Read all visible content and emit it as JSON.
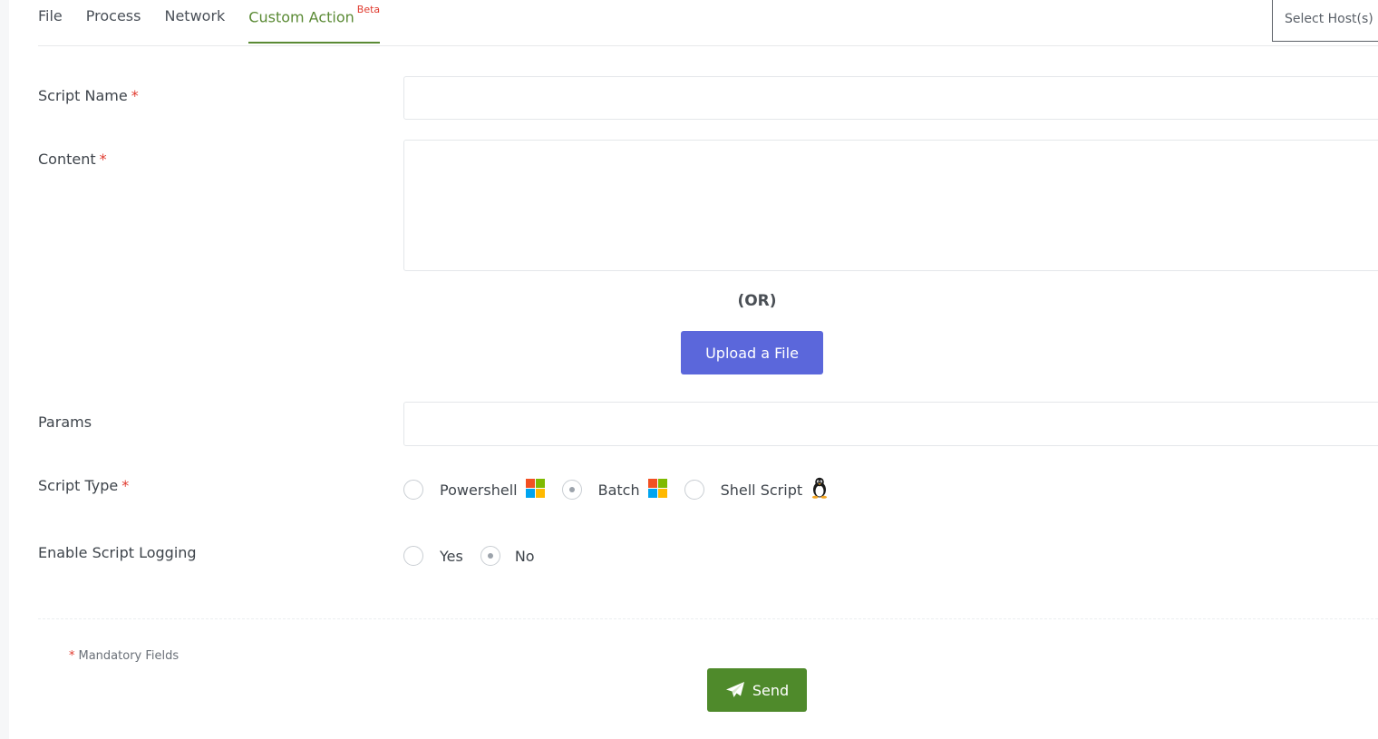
{
  "tabs": [
    {
      "label": "File"
    },
    {
      "label": "Process"
    },
    {
      "label": "Network"
    },
    {
      "label": "Custom Action",
      "badge": "Beta",
      "active": true
    }
  ],
  "host_select": {
    "placeholder": "Select Host(s)"
  },
  "form": {
    "script_name": {
      "label": "Script Name",
      "required": "*",
      "value": ""
    },
    "content": {
      "label": "Content",
      "required": "*",
      "value": ""
    },
    "or_text": "(OR)",
    "upload_label": "Upload a File",
    "params": {
      "label": "Params",
      "value": ""
    },
    "script_type": {
      "label": "Script Type",
      "required": "*",
      "options": [
        {
          "label": "Powershell",
          "icon": "windows-icon",
          "checked": false
        },
        {
          "label": "Batch",
          "icon": "windows-icon",
          "checked": true
        },
        {
          "label": "Shell Script",
          "icon": "linux-icon",
          "checked": false
        }
      ]
    },
    "logging": {
      "label": "Enable Script Logging",
      "options": [
        {
          "label": "Yes",
          "checked": false
        },
        {
          "label": "No",
          "checked": true
        }
      ]
    }
  },
  "footer": {
    "mandatory_star": "*",
    "mandatory_text": "Mandatory Fields",
    "send_label": "Send",
    "send_icon": "paper-plane-icon"
  },
  "colors": {
    "accent_green": "#5a8a34",
    "send_green": "#4f8a2b",
    "upload_blue": "#5b67db",
    "required_red": "#e03a2e"
  }
}
